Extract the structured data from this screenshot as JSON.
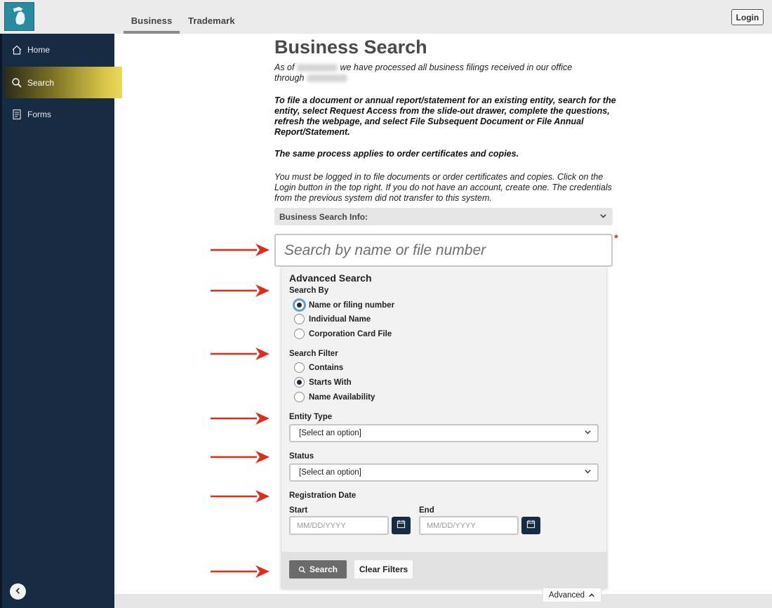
{
  "header": {
    "logo_icon": "michigan-state-logo-icon",
    "tabs": [
      {
        "label": "Business",
        "active": true
      },
      {
        "label": "Trademark",
        "active": false
      }
    ],
    "login_label": "Login"
  },
  "sidebar": {
    "items": [
      {
        "label": "Home",
        "icon": "home-icon"
      },
      {
        "label": "Search",
        "icon": "search-icon",
        "active": true
      },
      {
        "label": "Forms",
        "icon": "forms-icon"
      }
    ],
    "collapse_icon": "chevron-left-icon"
  },
  "main": {
    "title": "Business Search",
    "asof_prefix": "As of",
    "asof_middle": "we have processed all business filings received in our office",
    "asof_through": "through",
    "file_instructions": "To file a document or annual report/statement for an existing entity, search for the entity, select Request Access from the slide-out drawer, complete the questions, refresh the webpage, and select File Subsequent Document or File Annual Report/Statement.",
    "same_process": "The same process applies to order certificates and copies.",
    "login_notice": "You must be logged in to file documents or order certificates and copies. Click on the Login button in the top right. If you do not have an account, create one. The credentials from the previous system did not transfer to this system.",
    "info_bar_label": "Business Search Info:",
    "search_placeholder": "Search by name or file number",
    "required_mark": "*"
  },
  "advanced": {
    "title": "Advanced Search",
    "search_by_label": "Search By",
    "search_by_options": [
      "Name or filing number",
      "Individual Name",
      "Corporation Card File"
    ],
    "search_by_selected": 0,
    "search_filter_label": "Search Filter",
    "search_filter_options": [
      "Contains",
      "Starts With",
      "Name Availability"
    ],
    "search_filter_selected": 1,
    "entity_type_label": "Entity Type",
    "entity_type_value": "[Select an option]",
    "status_label": "Status",
    "status_value": "[Select an option]",
    "registration_date_label": "Registration Date",
    "start_label": "Start",
    "end_label": "End",
    "date_placeholder": "MM/DD/YYYY",
    "search_button": "Search",
    "clear_button": "Clear Filters",
    "toggle_label": "Advanced"
  },
  "colors": {
    "sidebar": "#172b43",
    "active_nav_gold": "#d8c648",
    "annotation_arrow": "#e32b1c"
  }
}
